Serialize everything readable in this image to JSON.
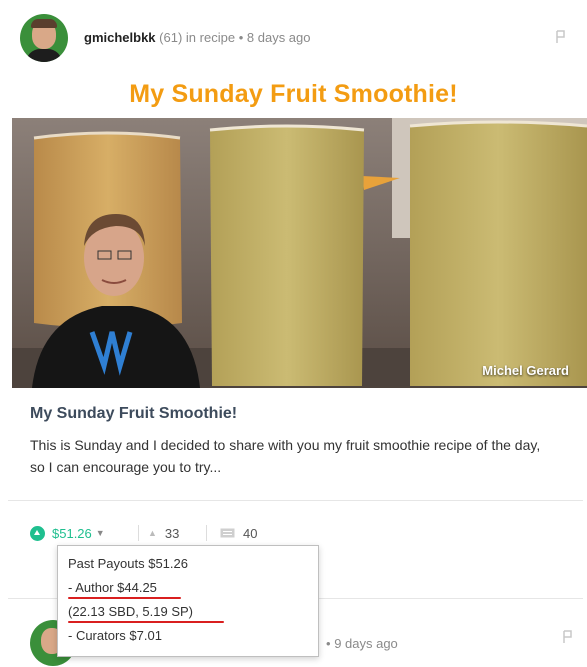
{
  "post": {
    "author": "gmichelbkk",
    "reputation": "(61)",
    "category_prefix": "in",
    "category": "recipe",
    "separator": "•",
    "time": "8 days ago",
    "image_title": "My Sunday Fruit Smoothie!",
    "image_watermark": "Michel Gerard",
    "title": "My Sunday Fruit Smoothie!",
    "excerpt": "This is Sunday and I decided to share with you my fruit smoothie recipe of the day, so I can encourage you to try..."
  },
  "footer": {
    "payout": "$51.26",
    "votes": "33",
    "comments": "40"
  },
  "payout_tooltip": {
    "past_payouts": "Past Payouts $51.26",
    "author": "- Author $44.25",
    "author_breakdown": "(22.13 SBD, 5.19 SP)",
    "curators": "- Curators $7.01"
  },
  "next_post": {
    "separator": "•",
    "time": "9 days ago"
  },
  "colors": {
    "title_orange": "#f39c12",
    "steem_green": "#1fbf8f",
    "underline_red": "#d91f1f"
  },
  "icons": [
    "pin-icon",
    "vote-icon",
    "caret-down-icon",
    "upvote-icon",
    "comment-icon"
  ]
}
